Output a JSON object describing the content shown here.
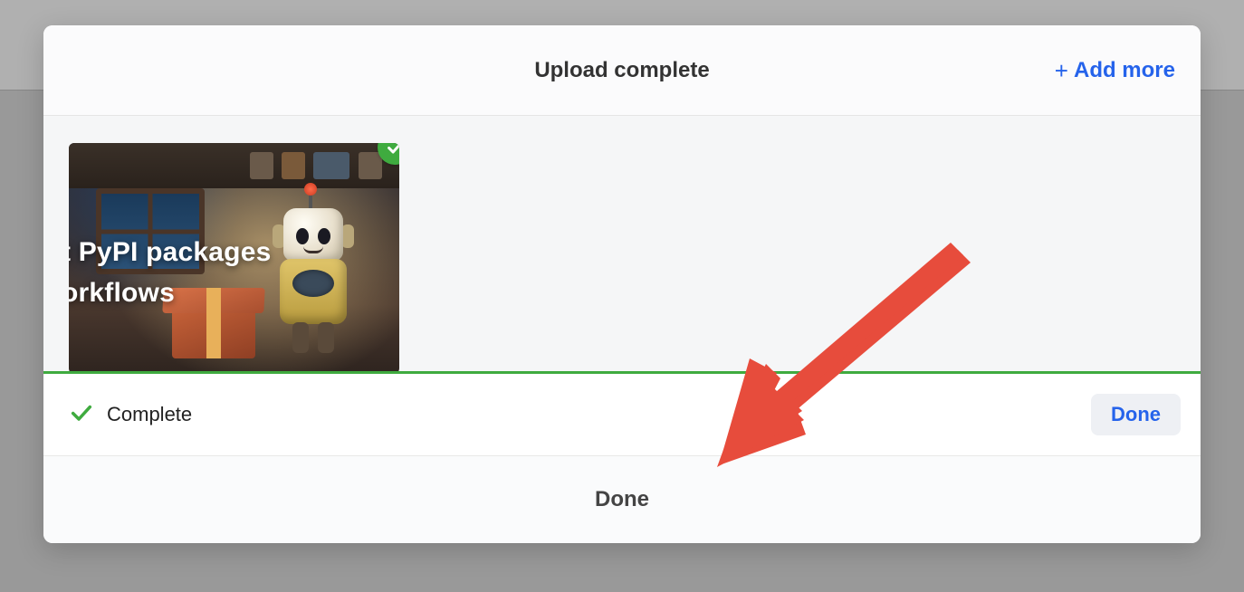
{
  "modal": {
    "title": "Upload complete",
    "add_more_label": "Add more"
  },
  "upload": {
    "thumbnail_text_line1": "t PyPI packages",
    "thumbnail_text_line2": "orkflows",
    "status_label": "Complete",
    "done_small_label": "Done"
  },
  "footer": {
    "done_label": "Done"
  },
  "colors": {
    "accent_green": "#3fab3f",
    "accent_blue": "#2563eb",
    "arrow_red": "#e74c3c"
  }
}
